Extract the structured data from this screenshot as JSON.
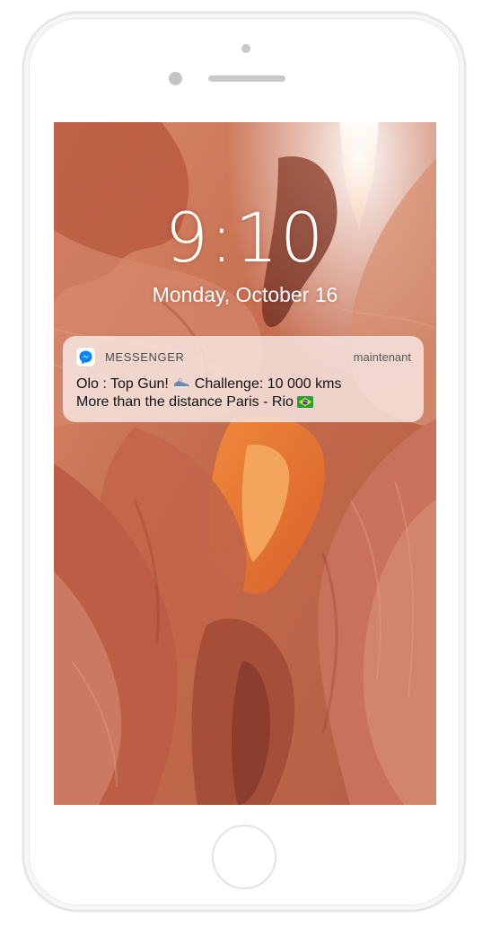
{
  "lock_screen": {
    "time": "9:10",
    "date": "Monday, October 16"
  },
  "notification": {
    "app_name": "MESSENGER",
    "app_icon": "messenger-icon",
    "timestamp": "maintenant",
    "line1_prefix": "Olo : Top Gun!",
    "line1_emoji": "running-shoe-emoji",
    "line1_suffix": "Challenge: 10 000 kms",
    "line2_text": "More than the distance Paris - Rio",
    "line2_emoji": "brazil-flag-emoji"
  },
  "colors": {
    "messenger_blue": "#0084ff",
    "notification_bg": "#f6e4e0",
    "wallpaper_base": "#c8704f"
  }
}
